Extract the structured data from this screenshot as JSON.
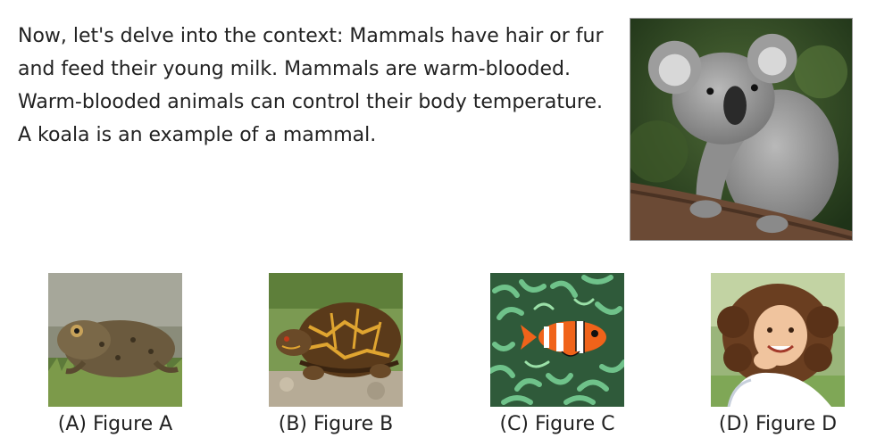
{
  "question": {
    "context": "Now, let's delve into the context: Mammals have hair or fur and feed their young milk. Mammals are warm-blooded. Warm-blooded animals can control their body temperature. A koala is an example of a mammal."
  },
  "main_image": {
    "icon": "koala-photo"
  },
  "choices": [
    {
      "label": "(A) Figure A",
      "icon": "toad-photo"
    },
    {
      "label": "(B) Figure B",
      "icon": "box-turtle-photo"
    },
    {
      "label": "(C) Figure C",
      "icon": "clownfish-photo"
    },
    {
      "label": "(D) Figure D",
      "icon": "smiling-girl-photo"
    }
  ]
}
